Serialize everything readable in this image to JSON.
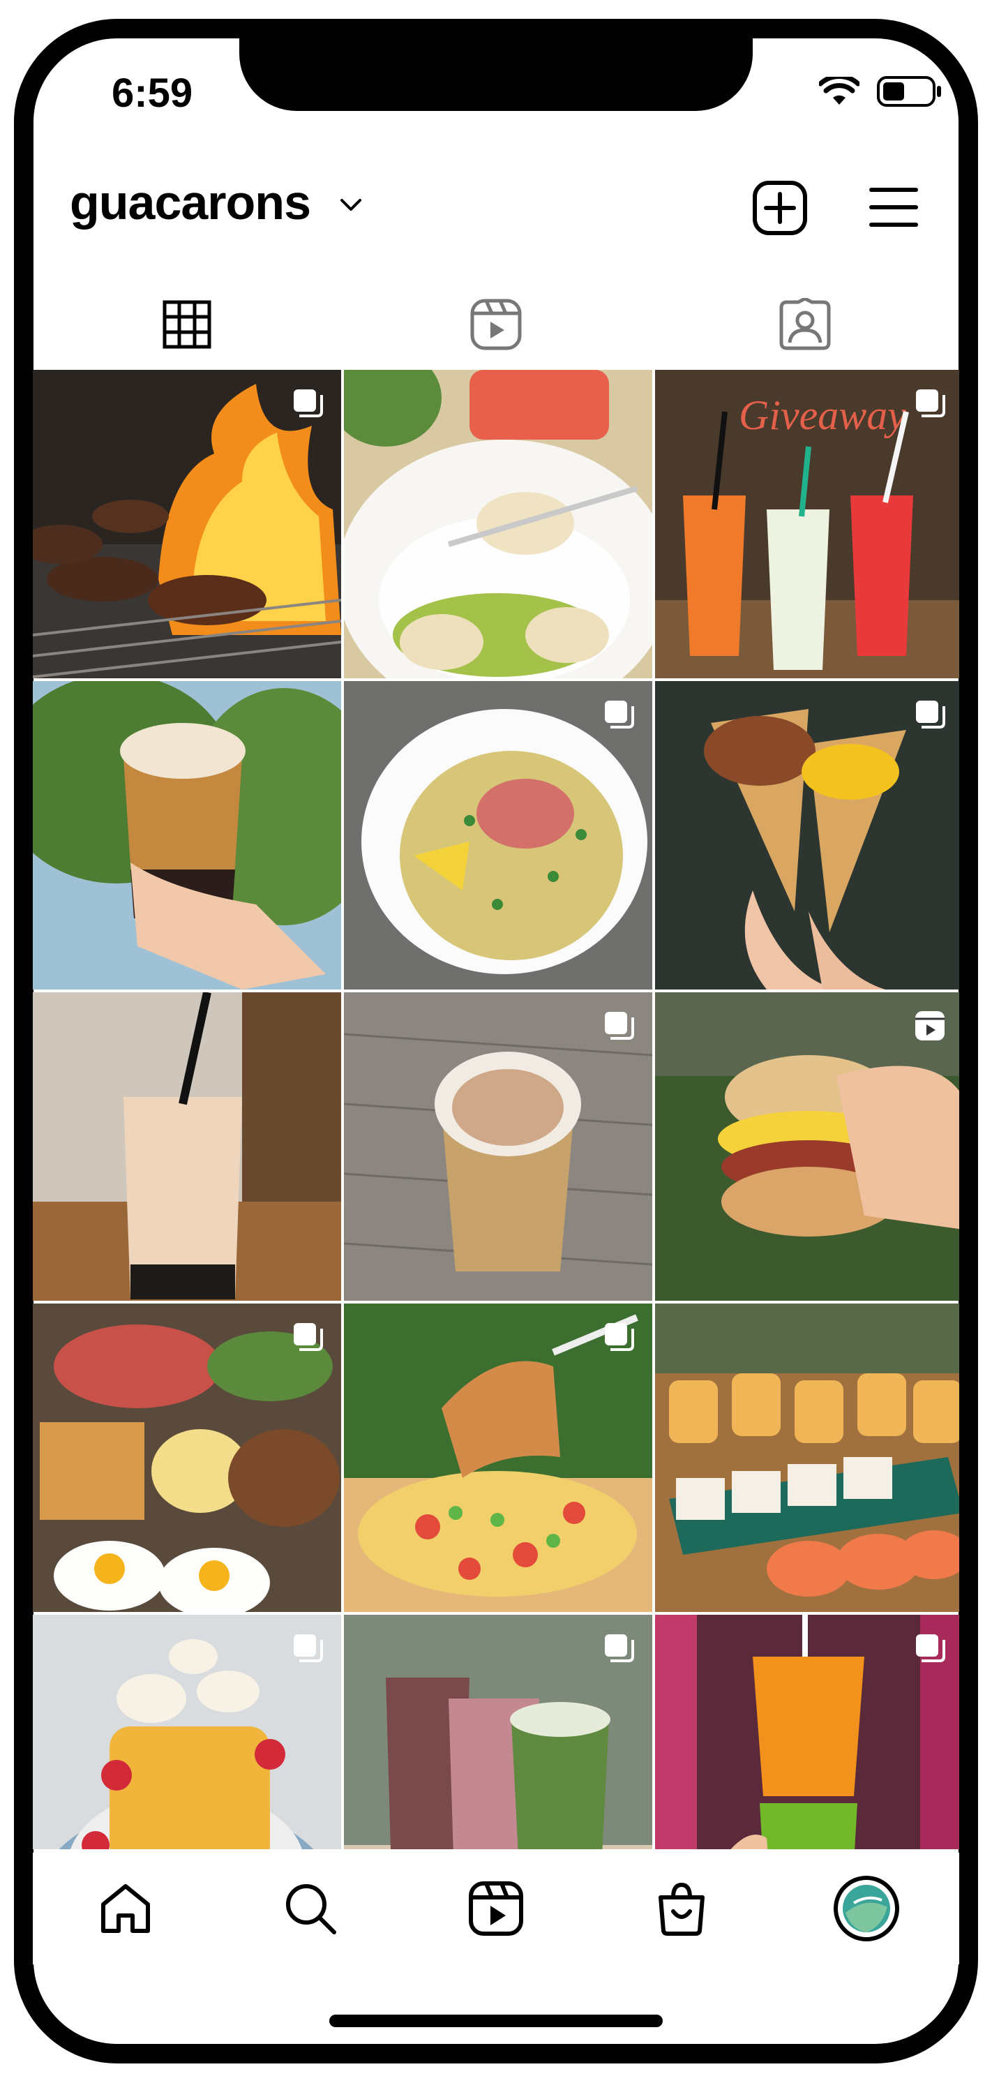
{
  "status": {
    "time": "6:59"
  },
  "header": {
    "username": "guacarons"
  },
  "icons": {
    "chevron": "chevron-down-icon",
    "add": "add-post-icon",
    "menu": "hamburger-menu-icon",
    "grid_tab": "grid-icon",
    "reels_tab": "reels-icon",
    "tagged_tab": "tagged-icon"
  },
  "colors": {
    "active": "#000000",
    "inactive": "#8e8e8e"
  },
  "posts": [
    {
      "name": "post-burgers-grill",
      "badge": "carousel"
    },
    {
      "name": "post-dumplings",
      "badge": "none"
    },
    {
      "name": "post-giveaway-drinks",
      "badge": "carousel"
    },
    {
      "name": "post-boba-tea",
      "badge": "none"
    },
    {
      "name": "post-poke-bowl",
      "badge": "carousel"
    },
    {
      "name": "post-waffle-cones",
      "badge": "carousel"
    },
    {
      "name": "post-milk-tea",
      "badge": "none"
    },
    {
      "name": "post-latte-cup",
      "badge": "carousel"
    },
    {
      "name": "post-breakfast-sandwich",
      "badge": "reel"
    },
    {
      "name": "post-brunch-spread",
      "badge": "carousel"
    },
    {
      "name": "post-loaded-fries",
      "badge": "carousel"
    },
    {
      "name": "post-sushi-rolls",
      "badge": "none"
    },
    {
      "name": "post-pancake-stack",
      "badge": "carousel"
    },
    {
      "name": "post-smoothie-cups",
      "badge": "carousel"
    },
    {
      "name": "post-juice-truck",
      "badge": "carousel"
    }
  ],
  "nav": [
    "home-icon",
    "search-icon",
    "reels-icon",
    "shop-icon",
    "profile-avatar"
  ]
}
